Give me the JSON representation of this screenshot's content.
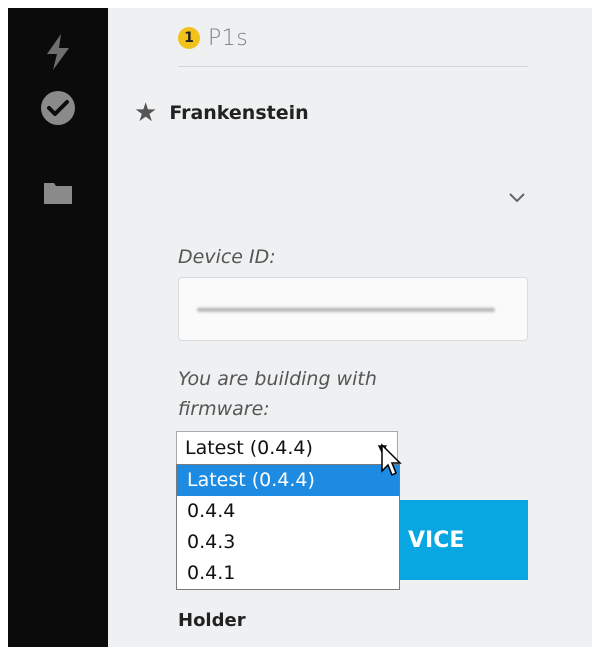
{
  "sidebar": {
    "icons": [
      {
        "name": "lightning-icon"
      },
      {
        "name": "check-circle-icon"
      },
      {
        "name": "folder-icon"
      }
    ]
  },
  "device_list": {
    "badge": "1",
    "p1s_label": "P1s",
    "starred_device_name": "Frankenstein"
  },
  "device_details": {
    "device_id_label": "Device ID:",
    "device_id_value": "",
    "firmware_label_line1": "You are building with",
    "firmware_label_line2": "firmware:",
    "firmware_selected": "Latest (0.4.4)",
    "firmware_options": [
      "Latest (0.4.4)",
      "0.4.4",
      "0.4.3",
      "0.4.1"
    ],
    "flash_button_visible_text": "VICE",
    "holder_label": "Holder"
  },
  "colors": {
    "accent_blue": "#08a7e1",
    "selection_blue": "#1e8be3",
    "badge_yellow": "#f3c21a",
    "panel_bg": "#eef0f1",
    "sidebar_bg": "#0b0b0b"
  }
}
